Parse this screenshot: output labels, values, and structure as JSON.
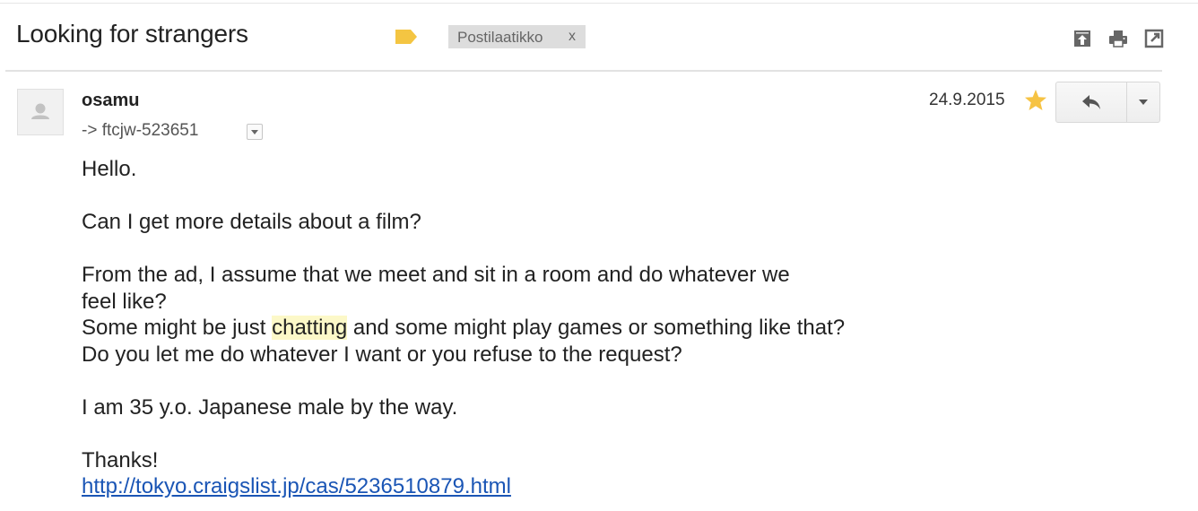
{
  "thread": {
    "subject": "Looking for strangers",
    "label": {
      "name": "Postilaatikko",
      "remove": "x",
      "tag_color": "#f4c542"
    },
    "toolbar_icons": [
      "archive-icon",
      "print-icon",
      "new-window-icon"
    ]
  },
  "message": {
    "sender": "osamu",
    "recipient": "-> ftcjw-523651",
    "date": "24.9.2015",
    "starred": true,
    "star_color": "#f6c343",
    "reply_icon": "reply-icon",
    "body": {
      "greeting": "Hello.",
      "question": "Can I get more details about a film?",
      "line3a": "From the ad, I assume that we meet and sit in a room and do whatever we",
      "line3b": "feel like?",
      "line4_pre": "Some might be just ",
      "line4_highlight": "chatting",
      "line4_post": " and some might play games or something like that?",
      "line5": "Do you let me do whatever I want or you refuse to the request?",
      "line6": "I am 35 y.o. Japanese male by the way.",
      "thanks": "Thanks!",
      "link": "http://tokyo.craigslist.jp/cas/5236510879.html"
    },
    "link_color": "#1a55b5",
    "highlight_color": "#fcf8c8"
  }
}
